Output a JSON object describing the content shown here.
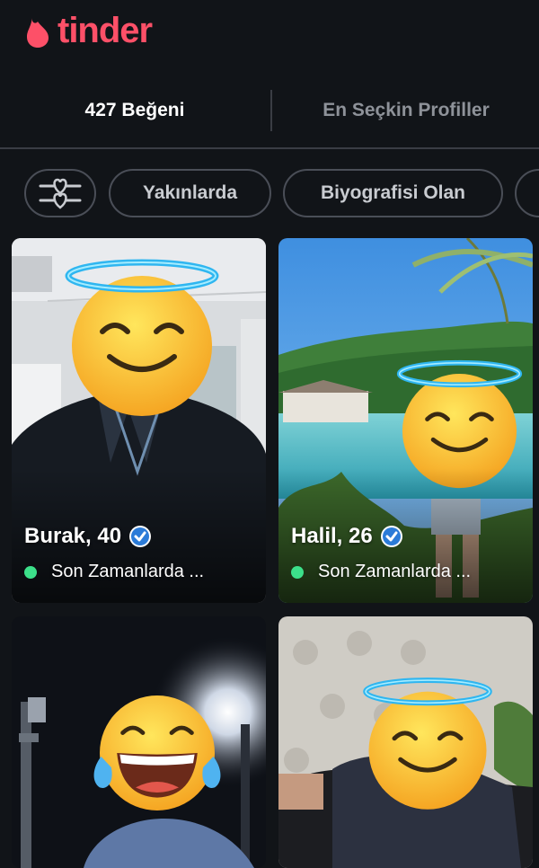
{
  "app": {
    "logo_text": "tinder",
    "brand_color": "#fd5068"
  },
  "tabs": [
    {
      "label": "427 Beğeni",
      "active": true
    },
    {
      "label": "En Seçkin Profiller",
      "active": false
    }
  ],
  "filters": {
    "filter_icon": "sliders-icon",
    "chips": [
      "Yakınlarda",
      "Biyografisi Olan"
    ]
  },
  "profiles": [
    {
      "name": "Burak, 40",
      "verified": true,
      "status": "Son Zamanlarda ...",
      "face": "smiling-halo-emoji"
    },
    {
      "name": "Halil, 26",
      "verified": true,
      "status": "Son Zamanlarda ...",
      "face": "smiling-halo-emoji"
    },
    {
      "face": "tears-of-joy-emoji"
    },
    {
      "face": "smiling-halo-emoji"
    }
  ],
  "colors": {
    "online_dot": "#3ce08a",
    "verified_badge": "#2b7bd8"
  }
}
